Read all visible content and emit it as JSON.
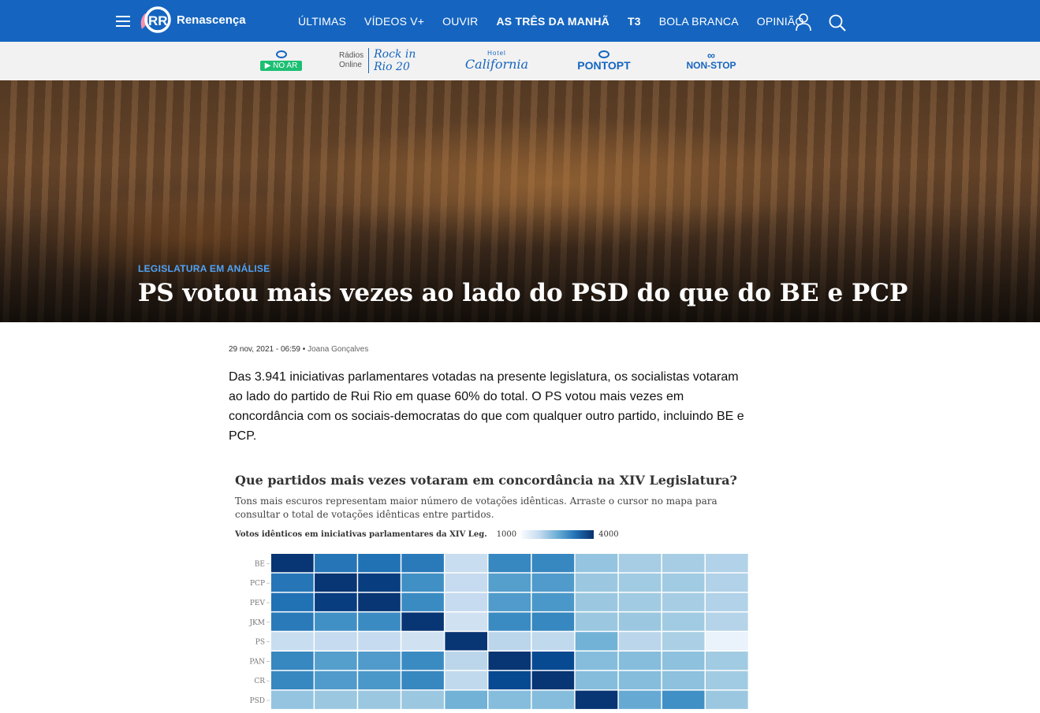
{
  "nav": {
    "brand": "Renascença",
    "items": [
      {
        "label": "ÚLTIMAS",
        "bold": false
      },
      {
        "label": "VÍDEOS V+",
        "bold": false
      },
      {
        "label": "OUVIR",
        "bold": false
      },
      {
        "label": "AS TRÊS DA MANHÃ",
        "bold": true
      },
      {
        "label": "T3",
        "bold": true
      },
      {
        "label": "BOLA BRANCA",
        "bold": false
      },
      {
        "label": "OPINIÃO",
        "bold": false
      }
    ],
    "icons": [
      "menu-icon",
      "user-icon",
      "search-icon"
    ],
    "colors": {
      "bar": "#1565c0",
      "text": "#ffffff"
    }
  },
  "radios": {
    "noar_label": "NO AR",
    "online_label_1": "Rádios",
    "online_label_2": "Online",
    "rockinrio": "Rock in Rio 20",
    "california_small": "Hotel",
    "california_big": "California",
    "pontopt": "PONTOPT",
    "nonstop": "NON-STOP"
  },
  "hero": {
    "kicker": "LEGISLATURA EM ANÁLISE",
    "title": "PS votou mais vezes ao lado do PSD do que do BE e PCP"
  },
  "article": {
    "date": "29 nov, 2021 - 06:59",
    "separator": "•",
    "author": "Joana Gonçalves",
    "lead": "Das 3.941 iniciativas parlamentares votadas na presente legislatura, os socialistas votaram ao lado do partido de Rui Rio em quase 60% do total. O PS votou mais vezes em concordância com os sociais-democratas do que com qualquer outro partido, incluindo BE e PCP."
  },
  "chart_data": {
    "type": "heatmap",
    "title": "Que partidos mais vezes votaram em concordância na XIV Legislatura?",
    "subtitle": "Tons mais escuros representam maior número de votações idênticas. Arraste o cursor no mapa para consultar o total de votações idênticas entre partidos.",
    "legend_title": "Votos idênticos em iniciativas parlamentares da XIV Leg.",
    "legend_min_label": "1000",
    "legend_max_label": "4000",
    "scale_min": 1000,
    "scale_max": 4000,
    "color_low": "#f7fbff",
    "color_high": "#08306b",
    "rows": [
      "BE",
      "PCP",
      "PEV",
      "JKM",
      "PS",
      "PAN",
      "CR",
      "PSD"
    ],
    "columns_count": 11,
    "values": [
      [
        3941,
        3200,
        3250,
        3150,
        1700,
        3000,
        3000,
        2200,
        2050,
        2050,
        1950
      ],
      [
        3200,
        3941,
        3850,
        2900,
        1750,
        2700,
        2750,
        2150,
        2100,
        2100,
        1950
      ],
      [
        3250,
        3850,
        3941,
        2950,
        1750,
        2750,
        2800,
        2150,
        2100,
        2050,
        1950
      ],
      [
        3150,
        2900,
        2950,
        3941,
        1600,
        2950,
        3000,
        2150,
        2150,
        2100,
        1900
      ],
      [
        1700,
        1750,
        1750,
        1600,
        3941,
        1850,
        1800,
        2450,
        1850,
        2000,
        1200
      ],
      [
        3000,
        2700,
        2750,
        2950,
        1850,
        3941,
        3700,
        2300,
        2300,
        2250,
        2100
      ],
      [
        3000,
        2750,
        2800,
        3000,
        1800,
        3700,
        3941,
        2300,
        2300,
        2250,
        2100
      ],
      [
        2200,
        2150,
        2150,
        2150,
        2450,
        2300,
        2300,
        3941,
        2550,
        2900,
        2150
      ]
    ]
  }
}
